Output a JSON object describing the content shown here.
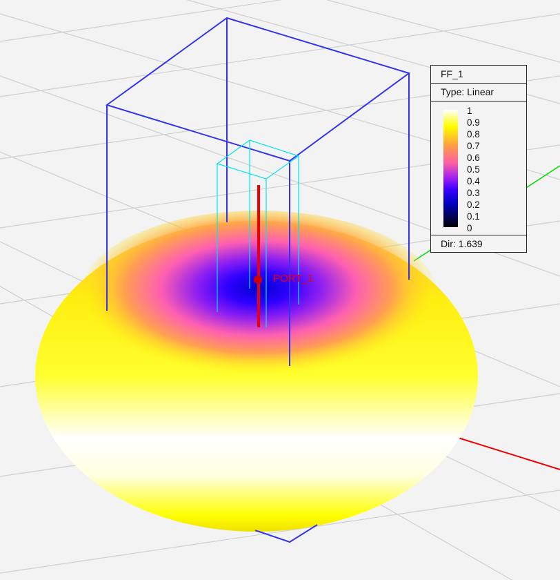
{
  "legend": {
    "title": "FF_1",
    "type_label": "Type: Linear",
    "ticks": [
      "1",
      "0.9",
      "0.8",
      "0.7",
      "0.6",
      "0.5",
      "0.4",
      "0.3",
      "0.2",
      "0.1",
      "0"
    ],
    "directivity": "Dir: 1.639"
  },
  "port_label": "PORT_1",
  "colors": {
    "box": "#3333ee",
    "feed_box": "#00e5ee",
    "port": "#ee0000",
    "x_axis": "#ee0000",
    "y_axis": "#00dd00",
    "grid": "#cfcfcf"
  }
}
